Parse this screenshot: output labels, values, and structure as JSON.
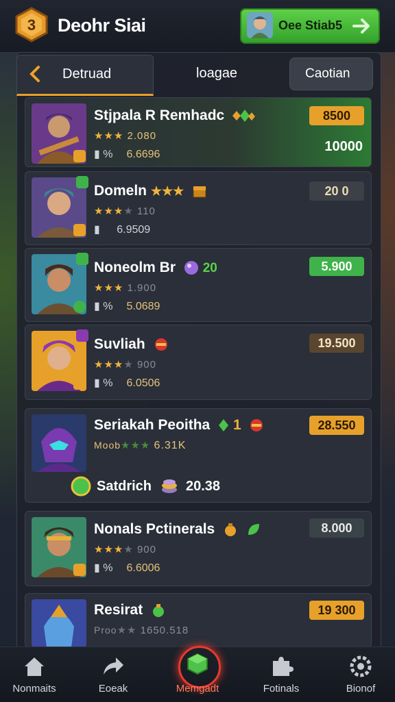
{
  "header": {
    "title": "Deohr Siai",
    "buy_button_label": "Oee Stiab5"
  },
  "tabs": {
    "back_label": "Detruad",
    "middle_label": "loagae",
    "right_label": "Caotian"
  },
  "items": [
    {
      "name": "Stjpala R Remhadc",
      "rating": "2.080",
      "percent": "%",
      "value": "6.6696",
      "price": "8500",
      "secondary": "10000",
      "stars": 3
    },
    {
      "name": "Domeln",
      "rating": "110",
      "percent": "",
      "value": "6.9509",
      "price": "20 0",
      "stars": 3
    },
    {
      "name": "Noneolm Br",
      "tag": "20",
      "rating": "1.900",
      "percent": "%",
      "value": "5.0689",
      "price": "5.900",
      "stars": 3
    },
    {
      "name": "Suvliah",
      "rating": "900",
      "percent": "%",
      "value": "6.0506",
      "price": "19.500",
      "stars": 3
    },
    {
      "name": "Seriakah Peoitha",
      "tag": "1",
      "rating_prefix": "Moob",
      "value": "6.31K",
      "price": "28.550",
      "footer_left": "Satdrich",
      "footer_right": "20.38"
    },
    {
      "name": "Nonals Pctinerals",
      "rating": "900",
      "percent": "%",
      "value": "6.6006",
      "price": "8.000",
      "stars": 3
    },
    {
      "name": "Resirat",
      "rating_prefix": "Proo",
      "rating": "1650.518",
      "price": "19 300"
    }
  ],
  "nav": [
    {
      "label": "Nonmaits",
      "icon": "home-icon"
    },
    {
      "label": "Eoeak",
      "icon": "share-arrow-icon"
    },
    {
      "label": "Memgadt",
      "icon": "cube-icon",
      "active": true
    },
    {
      "label": "Fotinals",
      "icon": "puzzle-icon"
    },
    {
      "label": "Bionof",
      "icon": "settings-gear-icon"
    }
  ],
  "colors": {
    "accent_orange": "#e7a12a",
    "accent_green": "#3fb34a",
    "active_red": "#e83a2e"
  }
}
